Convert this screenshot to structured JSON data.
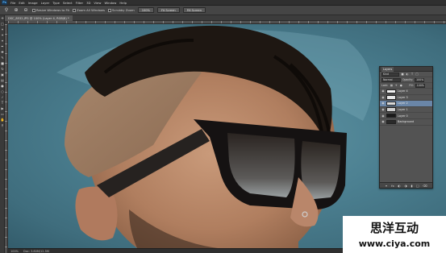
{
  "menubar": {
    "app_badge": "Ps",
    "items": [
      "File",
      "Edit",
      "Image",
      "Layer",
      "Type",
      "Select",
      "Filter",
      "3D",
      "View",
      "Window",
      "Help"
    ]
  },
  "options": {
    "check_resize_windows": "Resize Windows to Fit",
    "check_zoom_all": "Zoom All Windows",
    "check_scrubby": "Scrubby Zoom",
    "btn_100": "100%",
    "btn_fit_screen": "Fit Screen",
    "btn_fill_screen": "Fill Screen"
  },
  "document": {
    "tab_title": "DSC_8532.JPG @ 100% (Layer 4, RGB/8) *"
  },
  "status": {
    "zoom": "100%",
    "doc_size": "Doc: 3.80M/12.5M"
  },
  "layers_panel": {
    "tab_label": "Layers",
    "kind_filter": "Kind",
    "blend_mode": "Normal",
    "opacity_label": "Opacity:",
    "opacity_value": "100%",
    "lock_label": "Lock:",
    "fill_label": "Fill:",
    "fill_value": "100%",
    "layers": [
      {
        "name": "Layer 4",
        "selected": false,
        "thumb_color": "#f2f2f2"
      },
      {
        "name": "Layer 3",
        "selected": false,
        "thumb_color": "#e6e6e6"
      },
      {
        "name": "Layer 2",
        "selected": true,
        "thumb_color": "#d9d9d9"
      },
      {
        "name": "Layer 1",
        "selected": false,
        "thumb_color": "#cfcfcf"
      },
      {
        "name": "Layer 0",
        "selected": false,
        "thumb_color": "#1a1a1a"
      },
      {
        "name": "Background",
        "selected": false,
        "thumb_color": "#2a2a2a"
      }
    ]
  },
  "watermark": {
    "line1": "思洋互动",
    "line2": "www.ciya.com"
  },
  "colors": {
    "accent_selected_layer": "#6a86a8",
    "canvas_bg": "#4b7f90",
    "ui_dark": "#3a3a3a"
  },
  "icons": {
    "zoom_tool": "zoom-icon",
    "hand_tool": "hand-icon",
    "move_tool": "move-icon",
    "eye": "eye-icon"
  }
}
